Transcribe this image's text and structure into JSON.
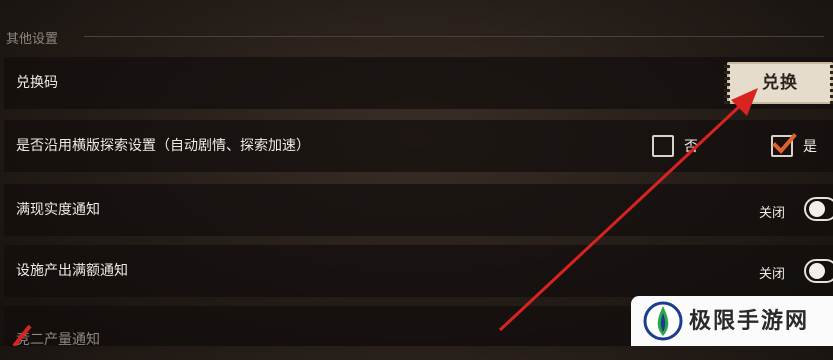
{
  "section": {
    "title": "其他设置"
  },
  "rows": {
    "redeem": {
      "label": "兑换码",
      "button_label": "兑换"
    },
    "horizontal_explore": {
      "label": "是否沿用横版探索设置（自动剧情、探索加速）",
      "option_no": "否",
      "option_yes": "是",
      "selected": "是"
    },
    "realism_notice": {
      "label": "满现实度通知",
      "state_text": "关闭",
      "enabled": false
    },
    "facility_notice": {
      "label": "设施产出满额通知",
      "state_text": "关闭",
      "enabled": false
    },
    "partial_row": {
      "label": "竞二产量通知"
    }
  },
  "colors": {
    "accent_check": "#e0622a",
    "annotation_arrow": "#d9231f"
  },
  "watermark": {
    "text": "极限手游网",
    "logo_icon": "jixian-logo-icon"
  }
}
